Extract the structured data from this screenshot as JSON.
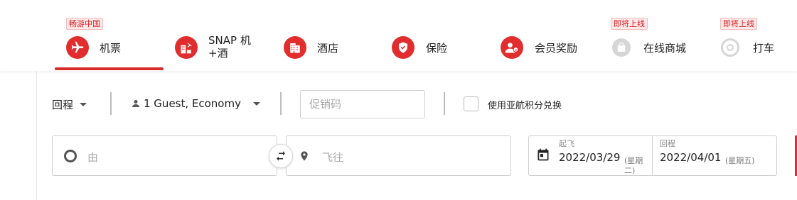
{
  "nav": {
    "tabs": [
      {
        "label": "机票",
        "badge": "畅游中国",
        "icon": "plane-icon"
      },
      {
        "label": "SNAP 机\n+酒",
        "badge": "",
        "icon": "flight-hotel-icon"
      },
      {
        "label": "酒店",
        "badge": "",
        "icon": "hotel-icon"
      },
      {
        "label": "保险",
        "badge": "",
        "icon": "insurance-shield-icon"
      },
      {
        "label": "会员奖励",
        "badge": "",
        "icon": "member-rewards-icon"
      },
      {
        "label": "在线商城",
        "badge": "即将上线",
        "icon": "shopping-bag-icon"
      },
      {
        "label": "打车",
        "badge": "即将上线",
        "icon": "ride-icon"
      }
    ],
    "active_tab": 0
  },
  "options": {
    "trip_type": "回程",
    "passengers": "1 Guest, Economy",
    "promo_placeholder": "促销码",
    "points_label": "使用亚航积分兑换"
  },
  "search": {
    "from_placeholder": "由",
    "to_placeholder": "飞往",
    "depart_label": "起飞",
    "depart_date": "2022/03/29",
    "depart_weekday_a": "(星期",
    "depart_weekday_b": "二)",
    "return_label": "回程",
    "return_date": "2022/04/01",
    "return_weekday": "(星期五)"
  },
  "colors": {
    "brand_red": "#e12d2d",
    "disabled": "#d6d6d6"
  }
}
